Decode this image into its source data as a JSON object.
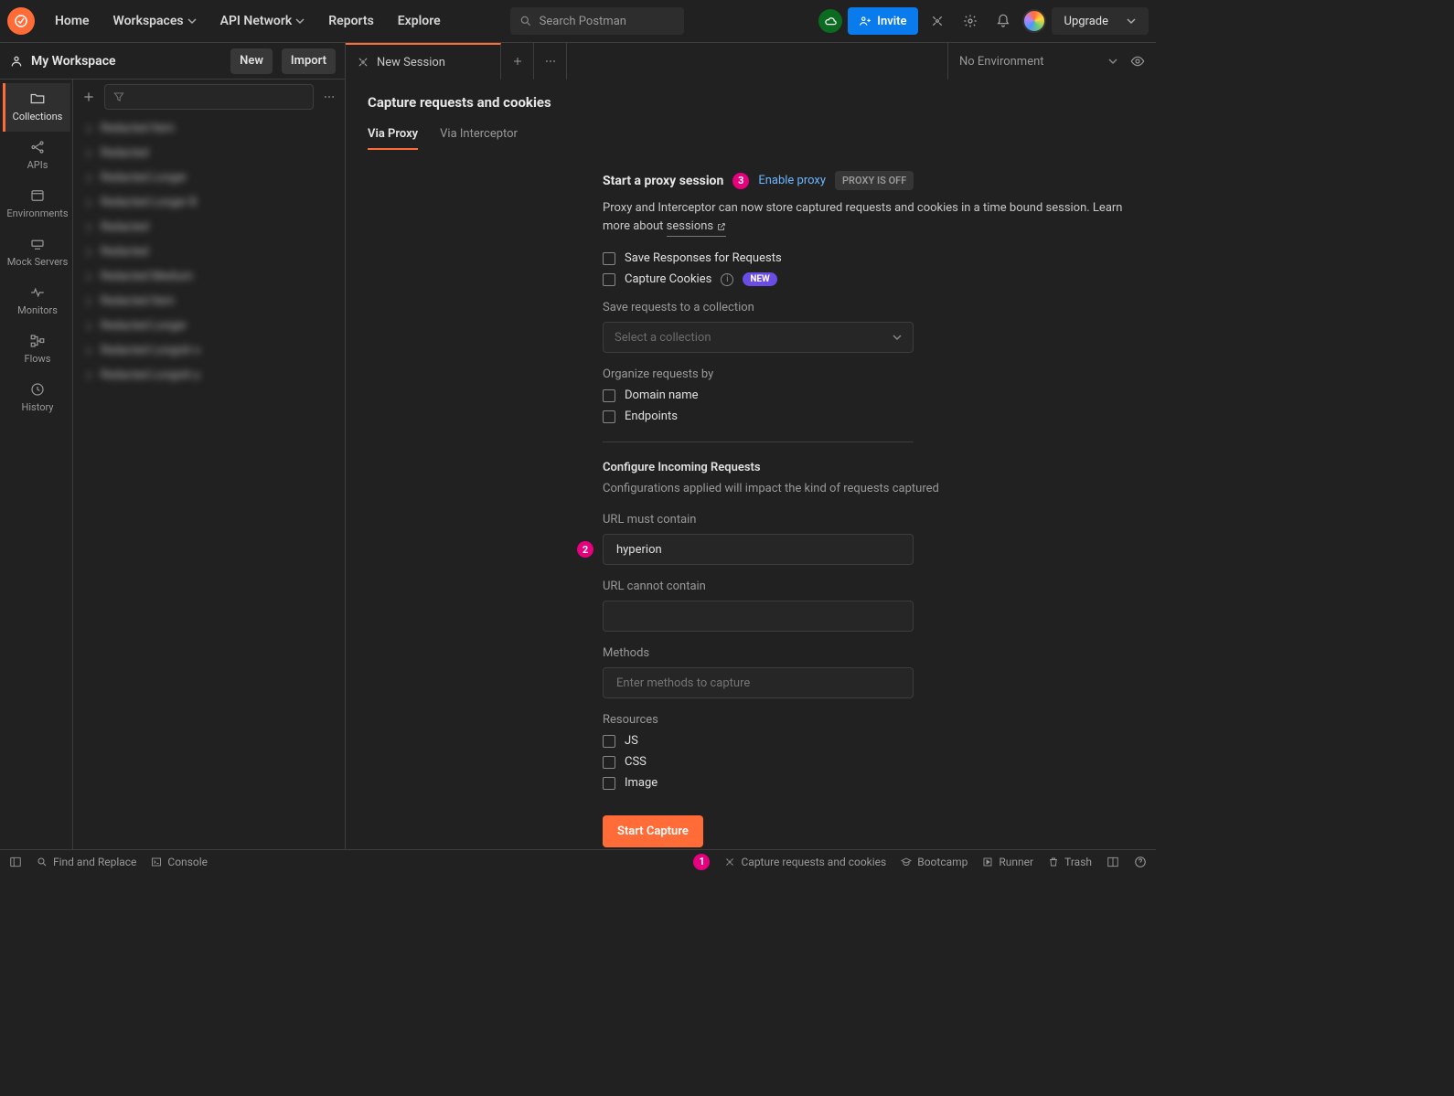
{
  "nav": {
    "home": "Home",
    "workspaces": "Workspaces",
    "api_network": "API Network",
    "reports": "Reports",
    "explore": "Explore",
    "search_placeholder": "Search Postman",
    "invite": "Invite",
    "upgrade": "Upgrade"
  },
  "workspace": {
    "name": "My Workspace",
    "new_btn": "New",
    "import_btn": "Import"
  },
  "rail": {
    "collections": "Collections",
    "apis": "APIs",
    "environments": "Environments",
    "mock_servers": "Mock Servers",
    "monitors": "Monitors",
    "flows": "Flows",
    "history": "History"
  },
  "tree_items": [
    "Redacted Item",
    "Redacted",
    "Redacted Longer",
    "Redacted Longer B",
    "Redacted",
    "Redacted",
    "Redacted Medium",
    "Redacted Item",
    "Redacted Longer",
    "Redacted Longish x",
    "Redacted Longish y"
  ],
  "tab": {
    "name": "New Session"
  },
  "env": {
    "selected": "No Environment"
  },
  "page": {
    "title": "Capture requests and cookies",
    "tabs": {
      "proxy": "Via Proxy",
      "interceptor": "Via Interceptor"
    }
  },
  "proxy": {
    "title": "Start a proxy session",
    "enable_link": "Enable proxy",
    "status_chip": "PROXY IS OFF",
    "desc_1": "Proxy and Interceptor can now store captured requests and cookies in a time bound session. Learn more about ",
    "sessions_link": "sessions",
    "save_responses": "Save Responses for Requests",
    "capture_cookies": "Capture Cookies",
    "new_badge": "NEW",
    "save_label": "Save requests to a collection",
    "select_placeholder": "Select a collection",
    "organize_label": "Organize requests by",
    "org_domain": "Domain name",
    "org_endpoints": "Endpoints"
  },
  "incoming": {
    "title": "Configure Incoming Requests",
    "subtitle": "Configurations applied will impact the kind of requests captured",
    "url_contain_label": "URL must contain",
    "url_contain_value": "hyperion",
    "url_not_label": "URL cannot contain",
    "methods_label": "Methods",
    "methods_placeholder": "Enter methods to capture",
    "resources_label": "Resources",
    "res_js": "JS",
    "res_css": "CSS",
    "res_image": "Image"
  },
  "start_btn": "Start Capture",
  "callouts": {
    "one": "1",
    "two": "2",
    "three": "3"
  },
  "footer": {
    "find": "Find and Replace",
    "console": "Console",
    "capture": "Capture requests and cookies",
    "bootcamp": "Bootcamp",
    "runner": "Runner",
    "trash": "Trash"
  }
}
